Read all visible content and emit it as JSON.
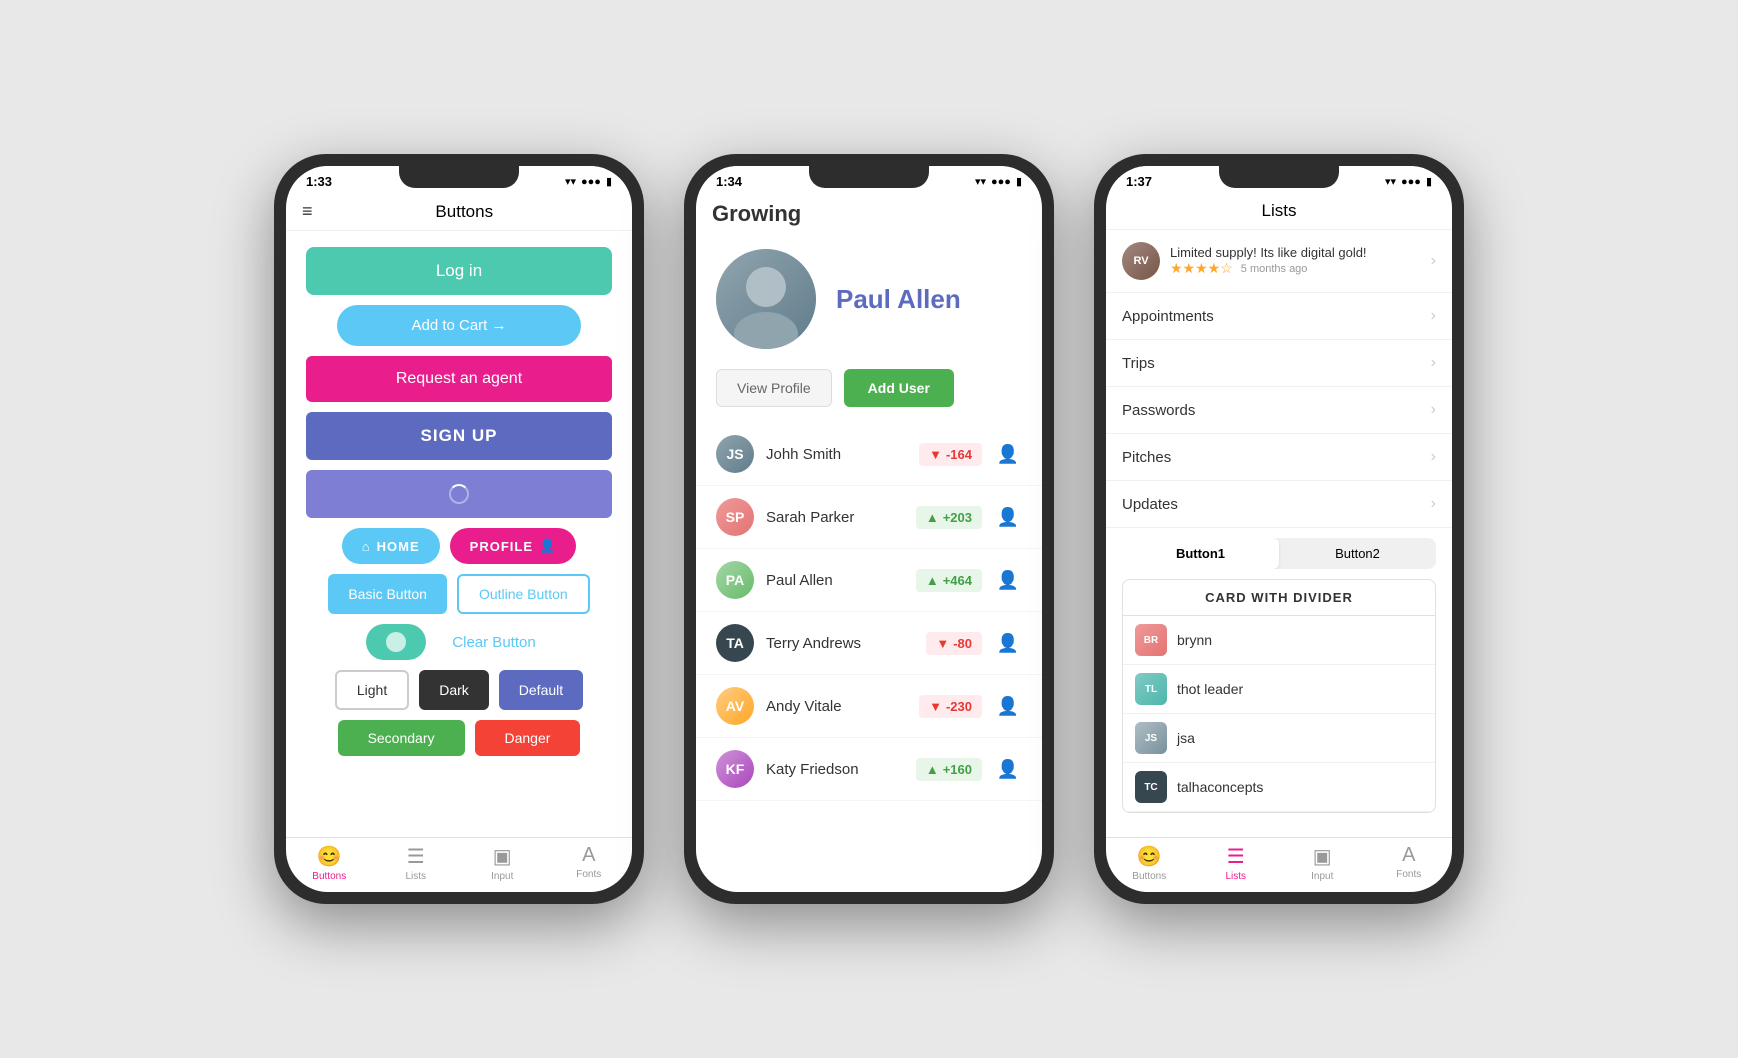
{
  "phone1": {
    "time": "1:33",
    "title": "Buttons",
    "buttons": {
      "login": "Log in",
      "addCart": "Add to Cart →",
      "agent": "Request an agent",
      "signup": "SIGN UP",
      "home": "HOME",
      "profile": "PROFILE",
      "basic": "Basic Button",
      "outline": "Outline Button",
      "clear": "Clear Button",
      "light": "Light",
      "dark": "Dark",
      "default": "Default",
      "secondary": "Secondary",
      "danger": "Danger"
    },
    "tabs": [
      {
        "label": "Buttons",
        "icon": "😊",
        "active": true
      },
      {
        "label": "Lists",
        "icon": "≡",
        "active": false
      },
      {
        "label": "Input",
        "icon": "⬜",
        "active": false
      },
      {
        "label": "Fonts",
        "icon": "A",
        "active": false
      }
    ]
  },
  "phone2": {
    "time": "1:34",
    "appTitle": "Growing",
    "profile": {
      "name": "Paul Allen",
      "viewProfile": "View Profile",
      "addUser": "Add User"
    },
    "users": [
      {
        "name": "Johh Smith",
        "score": "-164",
        "positive": false
      },
      {
        "name": "Sarah Parker",
        "score": "+203",
        "positive": true
      },
      {
        "name": "Paul Allen",
        "score": "+464",
        "positive": true
      },
      {
        "name": "Terry Andrews",
        "score": "-80",
        "positive": false
      },
      {
        "name": "Andy Vitale",
        "score": "-230",
        "positive": false
      },
      {
        "name": "Katy Friedson",
        "score": "+160",
        "positive": true
      }
    ]
  },
  "phone3": {
    "time": "1:37",
    "title": "Lists",
    "review": {
      "text": "Limited supply! Its like digital gold!",
      "stars": "★★★★☆",
      "time": "5 months ago"
    },
    "listItems": [
      "Appointments",
      "Trips",
      "Passwords",
      "Pitches",
      "Updates"
    ],
    "segTabs": [
      "Button1",
      "Button2"
    ],
    "cardTitle": "CARD WITH DIVIDER",
    "cardUsers": [
      "brynn",
      "thot leader",
      "jsa",
      "talhaconcepts"
    ],
    "tabs": [
      {
        "label": "Buttons",
        "icon": "😊",
        "active": false
      },
      {
        "label": "Lists",
        "icon": "≡",
        "active": true
      },
      {
        "label": "Input",
        "icon": "⬜",
        "active": false
      },
      {
        "label": "Fonts",
        "icon": "A",
        "active": false
      }
    ]
  }
}
